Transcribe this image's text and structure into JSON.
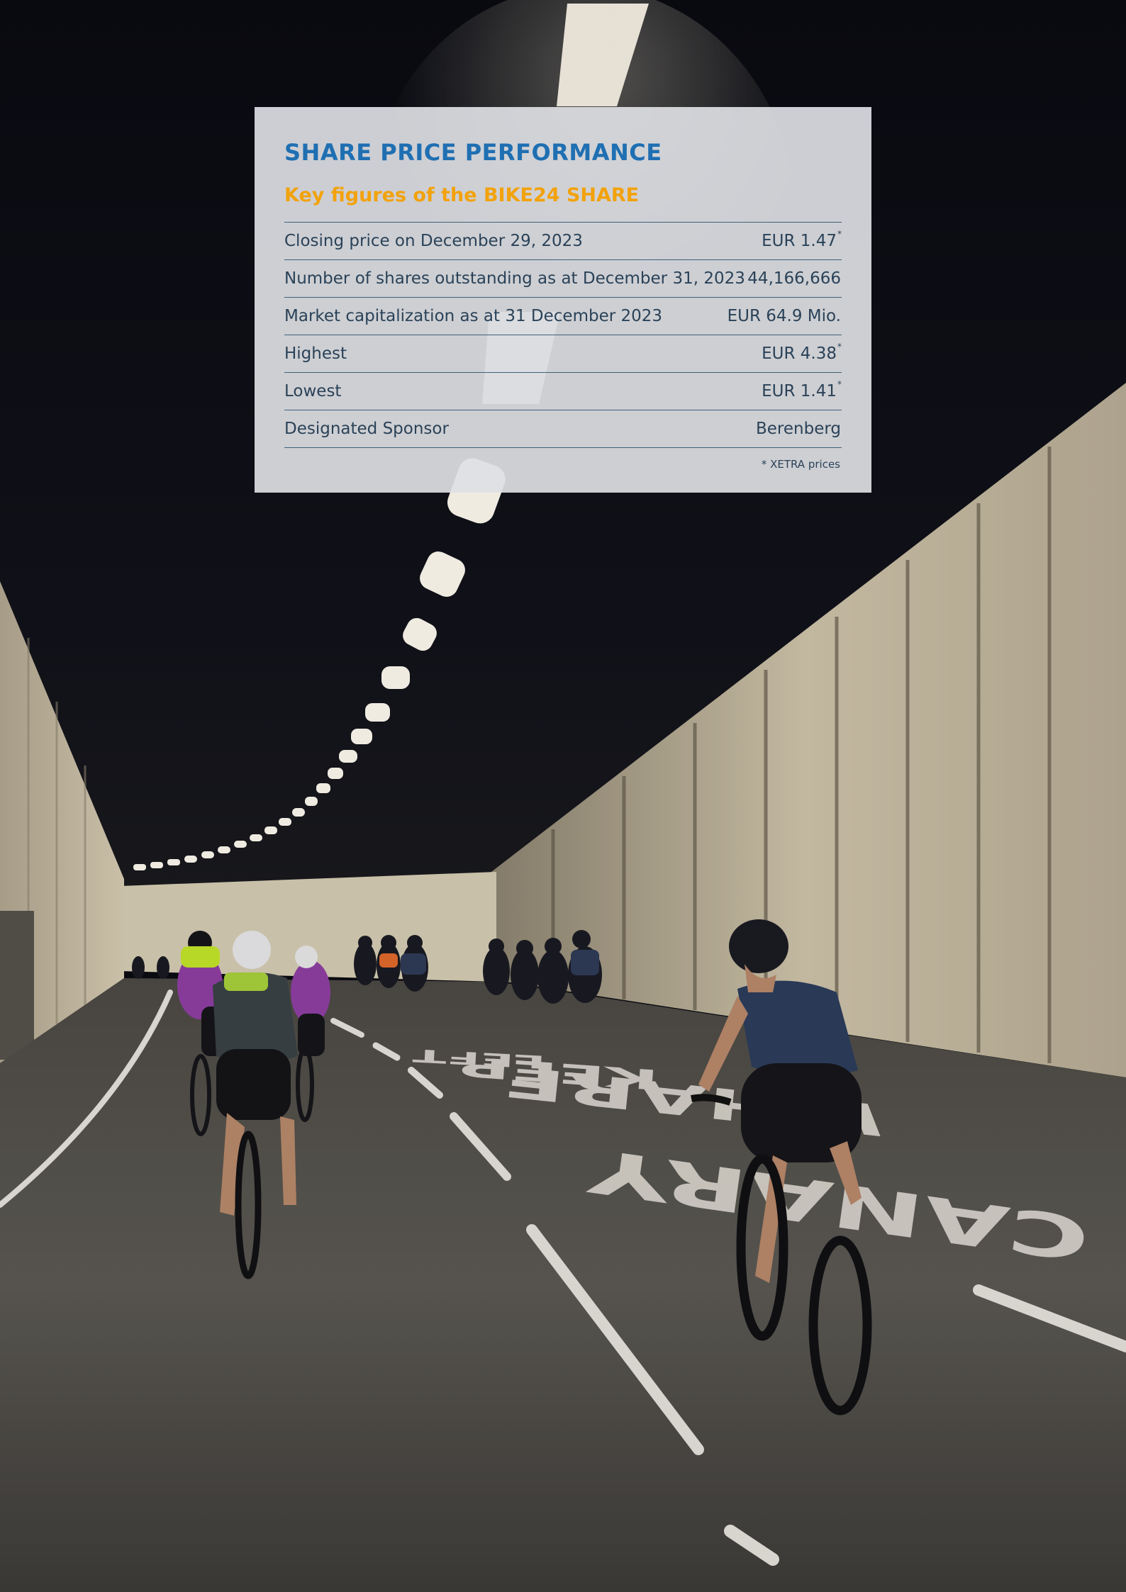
{
  "panel": {
    "title": "SHARE PRICE PERFORMANCE",
    "subtitle": "Key figures of the BIKE24 SHARE",
    "rows": [
      {
        "label": "Closing price on December 29, 2023",
        "value": "EUR 1.47",
        "marker": "*"
      },
      {
        "label": "Number of shares outstanding as at December 31, 2023",
        "value": "44,166,666",
        "marker": ""
      },
      {
        "label": "Market capitalization as at 31 December 2023",
        "value": "EUR 64.9 Mio.",
        "marker": ""
      },
      {
        "label": "Highest",
        "value": "EUR 4.38",
        "marker": "*"
      },
      {
        "label": "Lowest",
        "value": "EUR 1.41",
        "marker": "*"
      },
      {
        "label": "Designated Sponsor",
        "value": "Berenberg",
        "marker": ""
      }
    ],
    "footnote": "* XETRA prices"
  },
  "background": {
    "road_markings": [
      "CANARY",
      "WHARF",
      "KEEP",
      "LEFT"
    ]
  },
  "colors": {
    "title": "#1f6fb2",
    "subtitle": "#f2a20c",
    "text": "#2a4258",
    "rule": "#3f6079"
  }
}
